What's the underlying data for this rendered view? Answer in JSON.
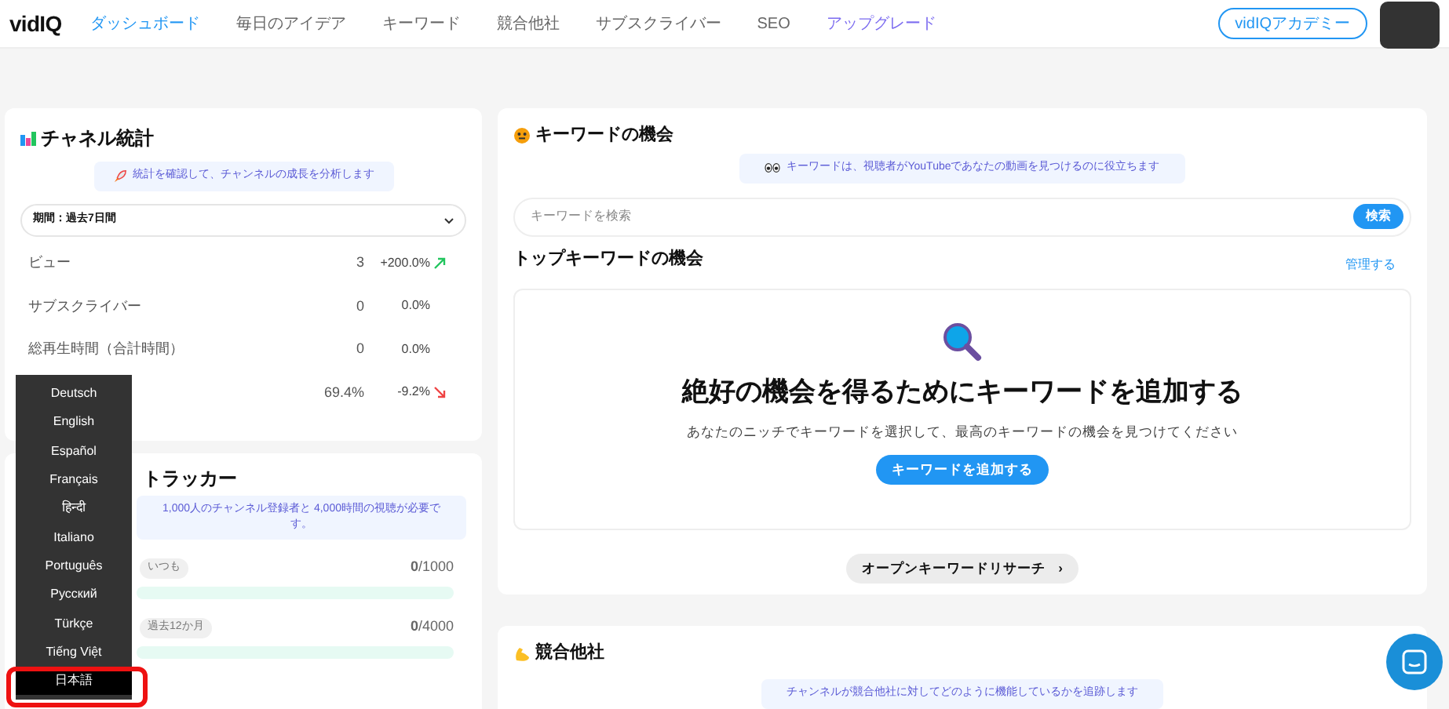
{
  "nav": {
    "logo": "vidIQ",
    "items": [
      {
        "label": "ダッシュボード",
        "selected": true
      },
      {
        "label": "毎日のアイデア",
        "selected": false
      },
      {
        "label": "キーワード",
        "selected": false
      },
      {
        "label": "競合他社",
        "selected": false
      },
      {
        "label": "サブスクライバー",
        "selected": false
      },
      {
        "label": "SEO",
        "selected": false
      },
      {
        "label": "アップグレード",
        "selected": false,
        "kind": "upgrade"
      }
    ],
    "academy": "vidIQアカデミー"
  },
  "channel_stats": {
    "title": "チャネル統計",
    "note": "統計を確認して、チャンネルの成長を分析します",
    "period": "期間：過去7日間",
    "rows": [
      {
        "label": "ビュー",
        "value": "3",
        "change": "+200.0%",
        "kind": "up"
      },
      {
        "label": "サブスクライバー",
        "value": "0",
        "change": "0.0%"
      },
      {
        "label": "総再生時間（合計時間）",
        "value": "0",
        "change": "0.0%"
      },
      {
        "value": "69.4%",
        "change": "-9.2%",
        "kind": "down"
      }
    ]
  },
  "tracker": {
    "title": "トラッカー",
    "note": "1,000人のチャンネル登録者と 4,000時間の視聴が必要です。",
    "rows": [
      {
        "badge": "いつも",
        "current": "0",
        "target": "/1000",
        "level": 0
      },
      {
        "badge": "過去12か月",
        "current": "0",
        "target": "/4000",
        "level": 0
      }
    ]
  },
  "keywords": {
    "title": "キーワードの機会",
    "note": "キーワードは、視聴者がYouTubeであなたの動画を見つけるのに役立ちます",
    "search": {
      "placeholder": "キーワードを検索",
      "button": "検索"
    },
    "top_title": "トップキーワードの機会",
    "manage": "管理する",
    "empty_title": "絶好の機会を得るためにキーワードを追加する",
    "empty_text": "あなたのニッチでキーワードを選択して、最高のキーワードの機会を見つけてください",
    "add_button": "キーワードを追加する",
    "open_button": "オープンキーワードリサーチ",
    "open_caret": "›"
  },
  "competitors": {
    "title": "競合他社",
    "note": "チャンネルが競合他社に対してどのように機能しているかを追跡します"
  },
  "language_menu": [
    {
      "label": "Deutsch",
      "selected": false
    },
    {
      "label": "English",
      "selected": false
    },
    {
      "label": "Español",
      "selected": false
    },
    {
      "label": "Français",
      "selected": false
    },
    {
      "label": "हिन्दी",
      "selected": false
    },
    {
      "label": "Italiano",
      "selected": false
    },
    {
      "label": "Português",
      "selected": false
    },
    {
      "label": "Русский",
      "selected": false
    },
    {
      "label": "Türkçe",
      "selected": false
    },
    {
      "label": "Tiếng Việt",
      "selected": false
    },
    {
      "label": "日本語",
      "selected": true
    }
  ]
}
